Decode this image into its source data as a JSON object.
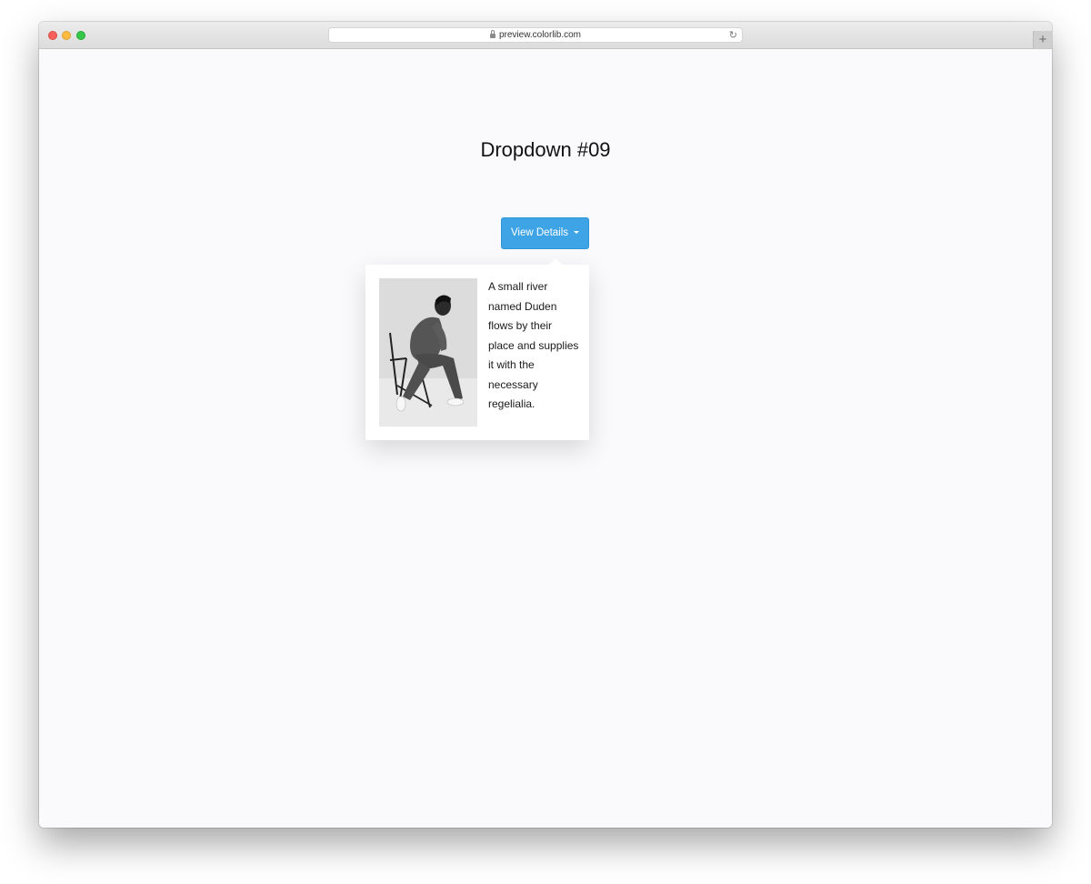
{
  "browser": {
    "url": "preview.colorlib.com",
    "new_tab_label": "+"
  },
  "page": {
    "title": "Dropdown #09",
    "button_label": "View Details",
    "dropdown": {
      "image_alt": "Person in gray suit sitting on a folding chair",
      "description": "A small river named Duden flows by their place and supplies it with the necessary regelialia."
    }
  },
  "colors": {
    "accent": "#3ea4e6",
    "page_background": "#faf9fb",
    "text": "#111111"
  },
  "icons": {
    "lock": "lock-icon",
    "reload": "reload-icon",
    "caret": "caret-down-icon",
    "new_tab": "plus-icon"
  }
}
